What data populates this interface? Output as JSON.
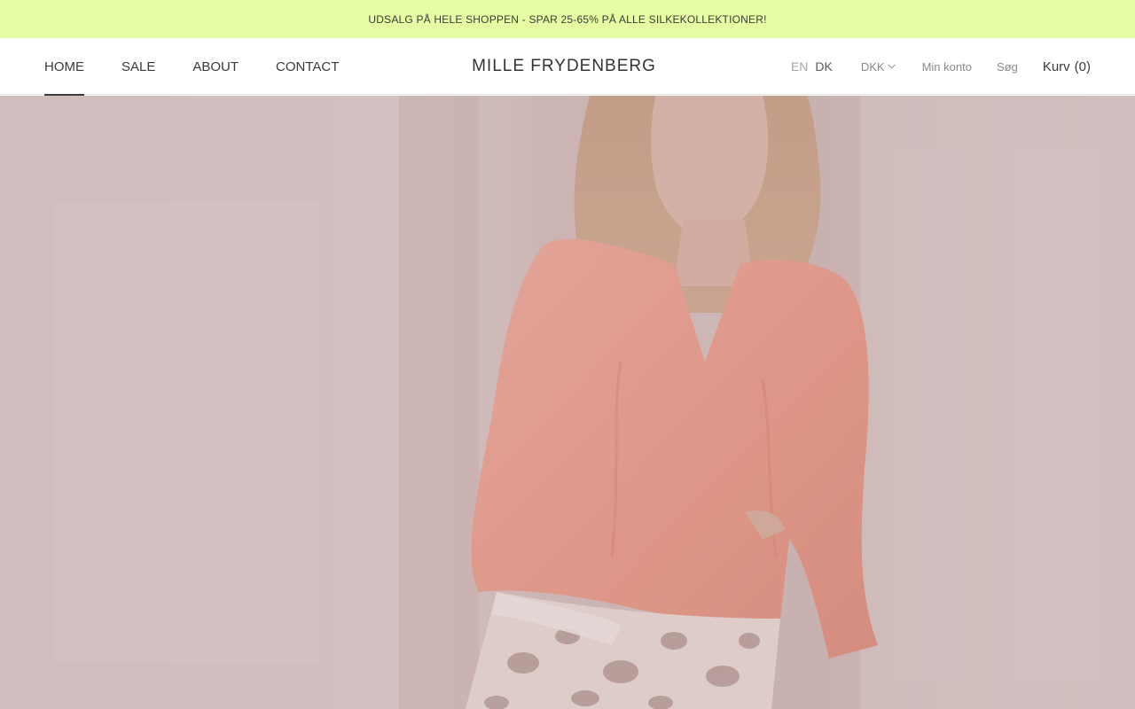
{
  "announcement": {
    "text": "UDSALG PÅ HELE SHOPPEN - SPAR 25-65% PÅ ALLE SILKEKOLLEKTIONER!"
  },
  "nav": {
    "items": [
      {
        "label": "HOME",
        "active": true
      },
      {
        "label": "SALE",
        "active": false
      },
      {
        "label": "ABOUT",
        "active": false
      },
      {
        "label": "CONTACT",
        "active": false
      }
    ]
  },
  "brand": {
    "logo_text": "MILLE FRYDENBERG"
  },
  "header_right": {
    "lang_en": "EN",
    "lang_dk": "DK",
    "currency": "DKK",
    "account": "Min konto",
    "search": "Søg",
    "cart_label": "Kurv",
    "cart_count": "(0)"
  },
  "hero": {
    "image": "woman-in-coral-silk-blouse-and-leopard-skirt"
  },
  "colors": {
    "announcement_bg": "#e6fea3",
    "hero_bg": "#d6c4c3",
    "blouse": "#e79a8d",
    "text": "#3a3a3a"
  }
}
